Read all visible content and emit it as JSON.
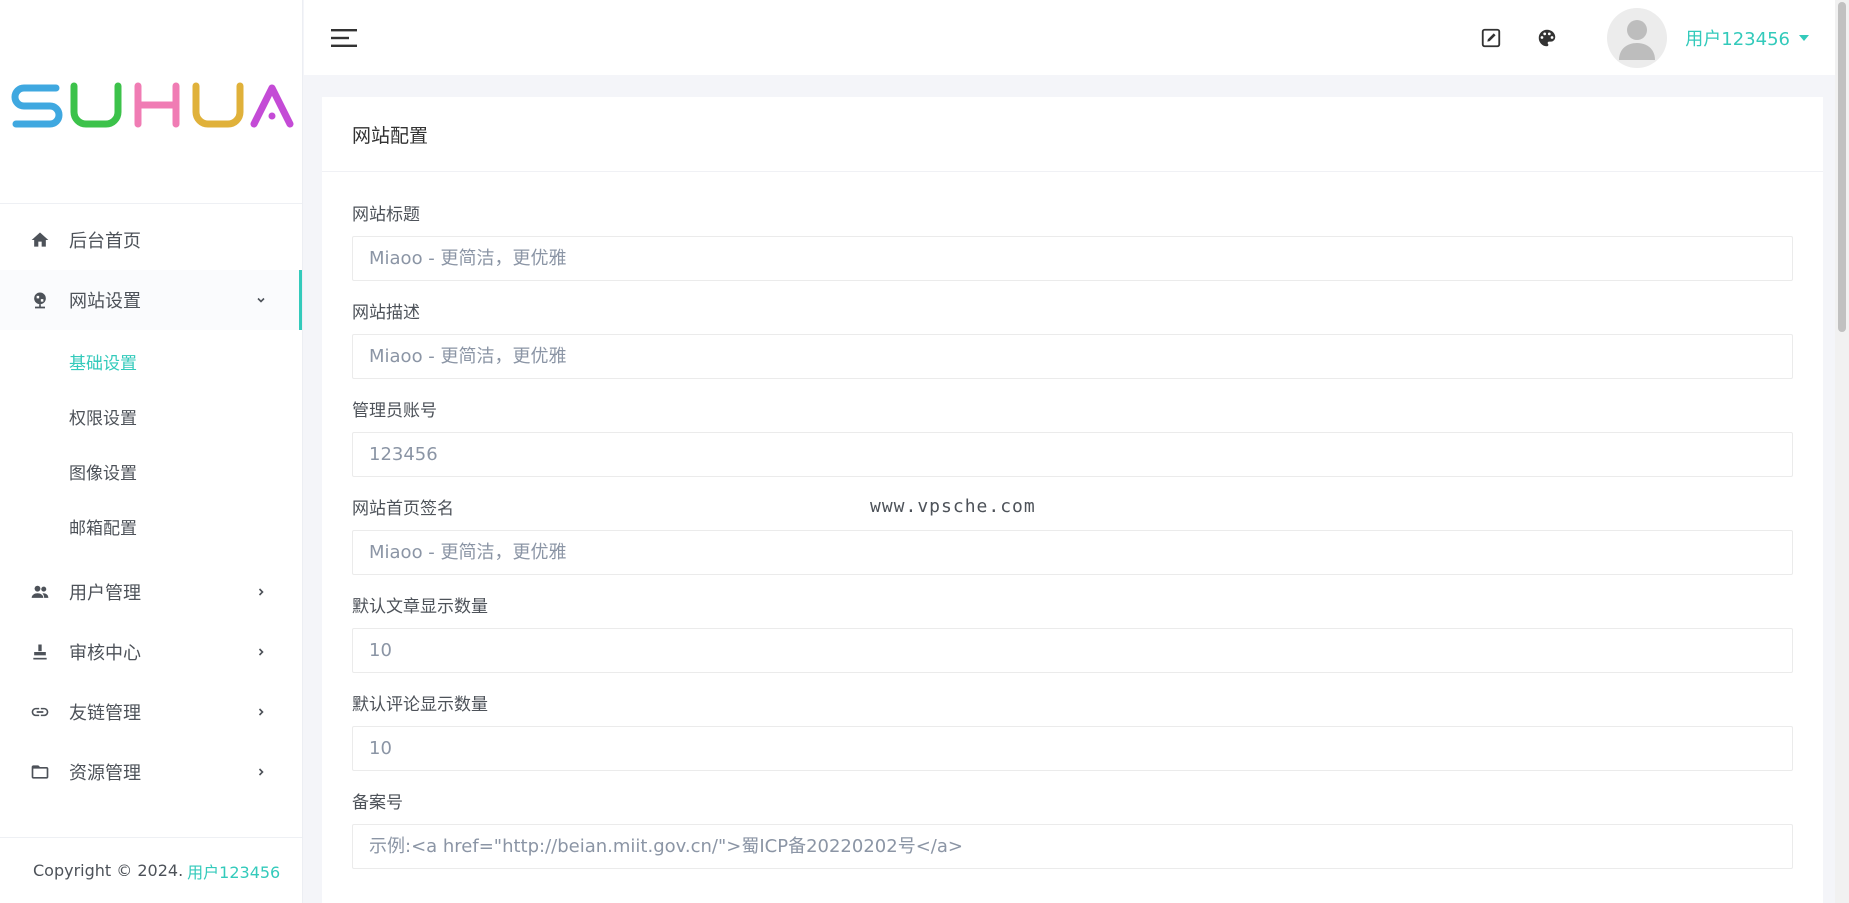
{
  "brand": {
    "logo_text": "SUHUA",
    "logo_colors": [
      "#3fa8e0",
      "#3cc24a",
      "#f07cb4",
      "#e0b13a",
      "#c44bd6"
    ]
  },
  "colors": {
    "accent": "#33cabb",
    "text": "#4d5259"
  },
  "sidebar": {
    "items": [
      {
        "label": "后台首页",
        "icon": "home-icon"
      },
      {
        "label": "网站设置",
        "icon": "globe-icon",
        "expanded": true
      },
      {
        "label": "用户管理",
        "icon": "users-icon"
      },
      {
        "label": "审核中心",
        "icon": "stamp-icon"
      },
      {
        "label": "友链管理",
        "icon": "link-icon"
      },
      {
        "label": "资源管理",
        "icon": "folder-icon"
      }
    ],
    "subitems": [
      {
        "label": "基础设置",
        "active": true
      },
      {
        "label": "权限设置"
      },
      {
        "label": "图像设置"
      },
      {
        "label": "邮箱配置"
      }
    ],
    "footer": {
      "copyright": "Copyright © 2024.",
      "link": "用户123456"
    }
  },
  "header": {
    "user_name": "用户123456",
    "icons": [
      "menu-icon",
      "edit-icon",
      "palette-icon",
      "avatar"
    ]
  },
  "card": {
    "title": "网站配置",
    "fields": [
      {
        "label": "网站标题",
        "placeholder": "Miaoo - 更简洁，更优雅"
      },
      {
        "label": "网站描述",
        "placeholder": "Miaoo - 更简洁，更优雅"
      },
      {
        "label": "管理员账号",
        "placeholder": "123456"
      },
      {
        "label": "网站首页签名",
        "placeholder": "Miaoo - 更简洁，更优雅"
      },
      {
        "label": "默认文章显示数量",
        "placeholder": "10"
      },
      {
        "label": "默认评论显示数量",
        "placeholder": "10"
      },
      {
        "label": "备案号",
        "placeholder": "示例:<a href=\"http://beian.miit.gov.cn/\">蜀ICP备20220202号</a>"
      }
    ]
  },
  "watermark": "www.vpsche.com"
}
